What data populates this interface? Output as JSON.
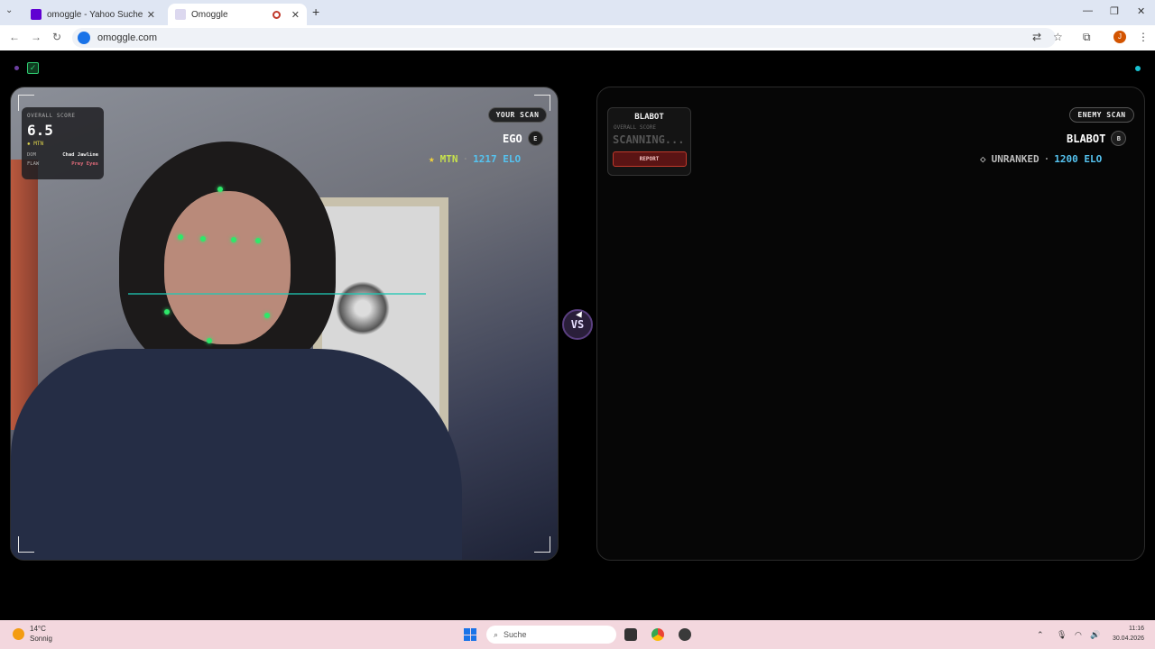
{
  "browser": {
    "tabs": [
      {
        "title": "omoggle - Yahoo Suche Suchen",
        "favicon": "yahoo-icon",
        "active": false
      },
      {
        "title": "Omoggle",
        "favicon": "omoggle-icon",
        "active": true
      }
    ],
    "url": "omoggle.com",
    "profile_initial": "J"
  },
  "player": {
    "panel_label": "YOUR SCAN",
    "name": "EGO",
    "rank_letter": "E",
    "tier": "MTN",
    "elo": "1217 ELO",
    "score_card": {
      "label": "OVERALL SCORE",
      "value": "6.5",
      "tier": "MTN",
      "rows": [
        {
          "key": "DOM",
          "value": "Chad Jawline"
        },
        {
          "key": "FLAW",
          "value": "Prey Eyes"
        }
      ]
    }
  },
  "enemy": {
    "panel_label": "ENEMY SCAN",
    "name": "BLABOT",
    "rank_letter": "B",
    "tier": "UNRANKED",
    "elo": "1200 ELO",
    "card": {
      "name": "BLABOT",
      "label": "OVERALL SCORE",
      "status": "SCANNING...",
      "report_label": "REPORT"
    }
  },
  "vs_label": "VS",
  "taskbar": {
    "temperature": "14°C",
    "condition": "Sonnig",
    "search_placeholder": "Suche",
    "time": "11:16",
    "date": "30.04.2026"
  },
  "colors": {
    "tier_accent": "#c7e24c",
    "elo_accent": "#55c3f0",
    "landmark": "#2ee86a",
    "report": "#c0392b"
  }
}
